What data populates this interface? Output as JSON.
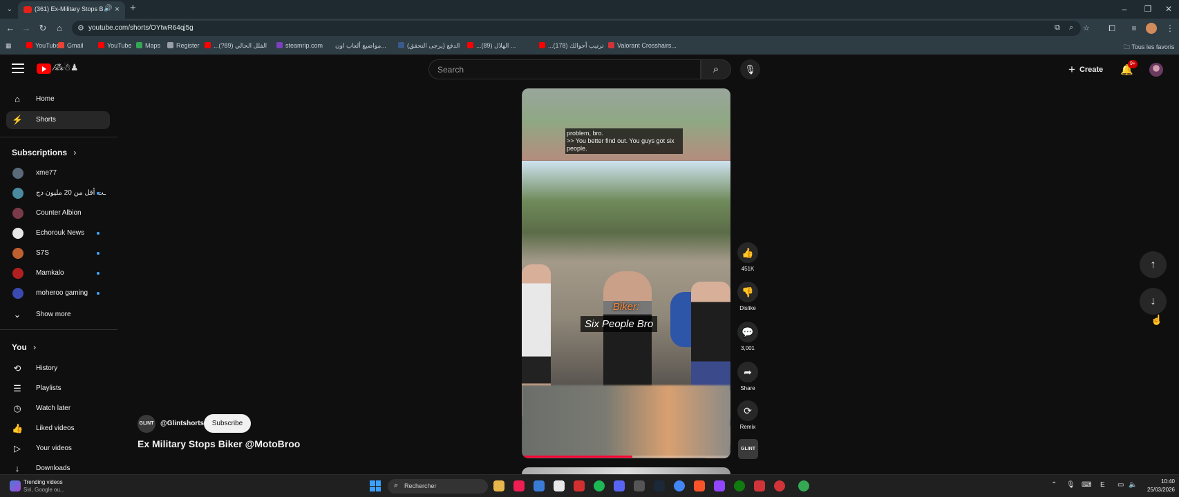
{
  "browser": {
    "tab_title": "(361) Ex-Military Stops Bik...",
    "url": "youtube.com/shorts/OYtwR64qj5g",
    "bookmarks": [
      {
        "label": "YouTube",
        "color": "#ff0000"
      },
      {
        "label": "Gmail",
        "color": "#ea4335"
      },
      {
        "label": "YouTube",
        "color": "#ff0000"
      },
      {
        "label": "Maps",
        "color": "#34a853"
      },
      {
        "label": "Register",
        "color": "#9aa0a6"
      },
      {
        "label": "...الفلل الحالي (89?)",
        "color": "#ff0000"
      },
      {
        "label": "steamrip.com",
        "color": "#7b3fbf"
      },
      {
        "label": "مواضيع ألعاب اون...",
        "color": "#2e3c44"
      },
      {
        "label": "(يرجى التحقق) الدفع",
        "color": "#3a5a8a"
      },
      {
        "label": "...الهلال (89) ...",
        "color": "#ff0000"
      },
      {
        "label": "...(178) ترتيب أحوالك",
        "color": "#ff0000"
      },
      {
        "label": "Valorant Crosshairs...",
        "color": "#d13438"
      }
    ],
    "all_bookmarks": "Tous les favoris"
  },
  "masthead": {
    "search_placeholder": "Search",
    "create_label": "Create",
    "notification_count": "9+"
  },
  "sidebar": {
    "main": [
      {
        "label": "Home",
        "icon": "home-icon"
      },
      {
        "label": "Shorts",
        "icon": "shorts-icon"
      }
    ],
    "subscriptions_heading": "Subscriptions",
    "subscriptions": [
      {
        "label": "xme77",
        "color": "#5a6a7a",
        "new": false
      },
      {
        "label": "ـت أقل من 20 مليون دج",
        "color": "#4a8aa0",
        "new": true
      },
      {
        "label": "Counter Albion",
        "color": "#7a3a4a",
        "new": false
      },
      {
        "label": "Echorouk News",
        "color": "#e8e8e8",
        "new": true
      },
      {
        "label": "S7S",
        "color": "#c06030",
        "new": true
      },
      {
        "label": "Mamkalo",
        "color": "#b02020",
        "new": true
      },
      {
        "label": "moheroo gaming",
        "color": "#3a4ab0",
        "new": true
      }
    ],
    "show_more": "Show more",
    "you_heading": "You",
    "you": [
      {
        "label": "History",
        "icon": "history-icon"
      },
      {
        "label": "Playlists",
        "icon": "playlists-icon"
      },
      {
        "label": "Watch later",
        "icon": "watch-later-icon"
      },
      {
        "label": "Liked videos",
        "icon": "liked-icon"
      },
      {
        "label": "Your videos",
        "icon": "your-videos-icon"
      },
      {
        "label": "Downloads",
        "icon": "downloads-icon"
      }
    ]
  },
  "short": {
    "channel_handle": "@Glintshorts",
    "channel_avatar_text": "GLINT",
    "subscribe_label": "Subscribe",
    "title": "Ex Military Stops Biker @MotoBroo",
    "caption_lines": [
      "problem, bro.",
      ">> You better find out. You guys got six",
      "people."
    ],
    "overlay_speaker": "Biker:",
    "overlay_line": "Six People Bro",
    "progress": 0.53,
    "actions": {
      "like_count": "451K",
      "dislike_label": "Dislike",
      "comment_count": "3,001",
      "share_label": "Share",
      "remix_label": "Remix"
    }
  },
  "taskbar": {
    "widget_title": "Trending videos",
    "widget_subtitle": "Siri, Google ou...",
    "search_text": "Rechercher",
    "time": "10:40",
    "date": "25/03/2026"
  },
  "colors": {
    "accent_red": "#ff0000",
    "background": "#0f0f0f",
    "link_blue": "#3ea6ff"
  }
}
